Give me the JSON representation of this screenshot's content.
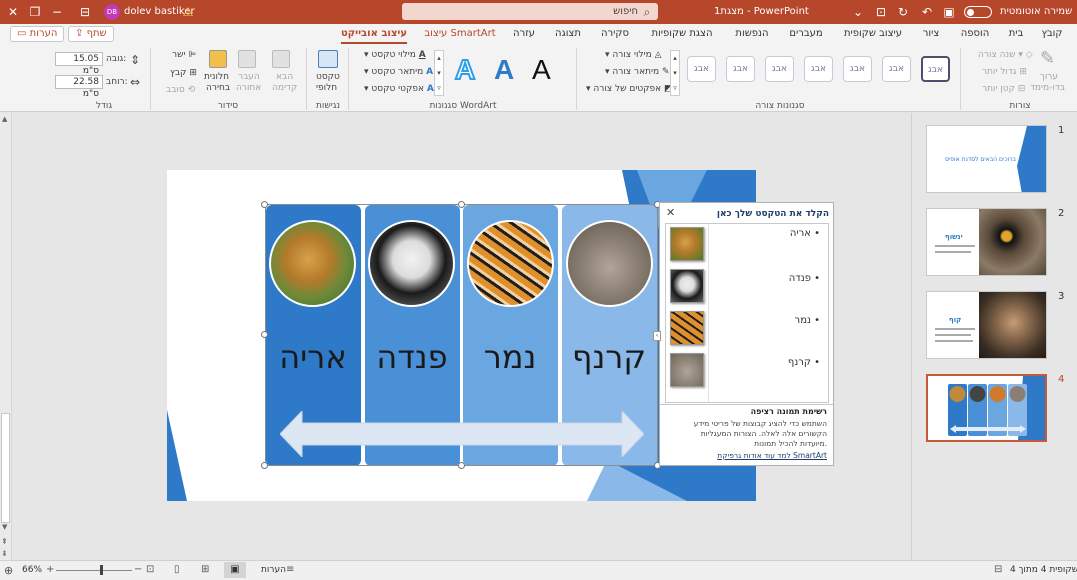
{
  "titlebar": {
    "autosave_label": "שמירה אוטומטית",
    "doc_title": "מצגת1 - PowerPoint",
    "search_placeholder": "חיפוש",
    "user_name": "dolev bastiker",
    "user_initials": "DB"
  },
  "tabs": [
    "קובץ",
    "בית",
    "הוספה",
    "ציור",
    "עיצוב שקופית",
    "מעברים",
    "הנפשות",
    "הצגת שקופיות",
    "סקירה",
    "תצוגה",
    "עזרה",
    "עיצוב SmartArt",
    "עיצוב אובייקט"
  ],
  "share_label": "שתף",
  "comments_label": "הערות",
  "ribbon": {
    "shapes_group": {
      "label": "צורות",
      "change_shape": "שנה צורה",
      "larger": "גדול יותר",
      "smaller": "קטן יותר",
      "edit_2d": "ערוך",
      "edit_2d_sub": "בדו-מימד"
    },
    "shape_styles": {
      "label": "סגנונות צורה",
      "swatch_text": "אבג",
      "fill": "מילוי צורה",
      "outline": "מיתאר צורה",
      "effects": "אפקטים של צורה"
    },
    "wordart": {
      "label": "סגנונות WordArt",
      "fill": "מילוי טקסט",
      "outline": "מיתאר טקסט",
      "effects": "אפקטי טקסט",
      "letter": "A"
    },
    "accessibility": {
      "label": "נגישות",
      "alt_text": "טקסט",
      "alt_text2": "חלופי"
    },
    "arrange": {
      "label": "סידור",
      "bring_forward": "הבא",
      "bring_forward2": "קדימה",
      "send_backward": "העבר",
      "send_backward2": "אחורה",
      "selection_pane": "חלונית",
      "selection_pane2": "בחירה",
      "align": "ישר",
      "group": "קבץ",
      "rotate": "סובב"
    },
    "size": {
      "label": "גודל",
      "height_label": "גובה:",
      "height_value": "15.05 ס\"מ",
      "width_label": "רוחב:",
      "width_value": "22.58 ס\"מ"
    }
  },
  "slide": {
    "columns": [
      {
        "name": "אריה",
        "photo": "lion-photo",
        "color": "#2e79c8"
      },
      {
        "name": "פנדה",
        "photo": "panda-photo",
        "color": "#4a90d6"
      },
      {
        "name": "נמר",
        "photo": "tiger-photo",
        "color": "#6aa6e0"
      },
      {
        "name": "קרנף",
        "photo": "rhino-photo",
        "color": "#8ab8e8"
      }
    ]
  },
  "text_pane": {
    "title": "הקלד את הטקסט שלך כאן",
    "items": [
      "אריה",
      "פנדה",
      "נמר",
      "קרנף"
    ],
    "desc_title": "רשימת תמונה רציפה",
    "desc_line1": "השתמש כדי להציג קבוצות של פריטי מידע",
    "desc_line2": "הקשורים אלה לאלה. הצורות המעגליות",
    "desc_line3": "מיועדות להכיל תמונות.",
    "learn_more": "למד עוד אודות גרפיקת SmartArt"
  },
  "thumbnails": [
    {
      "num": "1",
      "title": "ברוכים הבאים לסדנת אופיס"
    },
    {
      "num": "2",
      "title": "ינשוף"
    },
    {
      "num": "3",
      "title": "קוף"
    },
    {
      "num": "4",
      "title": ""
    }
  ],
  "status": {
    "slide_info": "שקופית 4 מתוך 4",
    "notes": "הערות",
    "zoom": "66%"
  },
  "colors": {
    "accent": "#b7472a",
    "slide_blue": "#2e79c8",
    "light_blue": "#8ab8e8"
  }
}
